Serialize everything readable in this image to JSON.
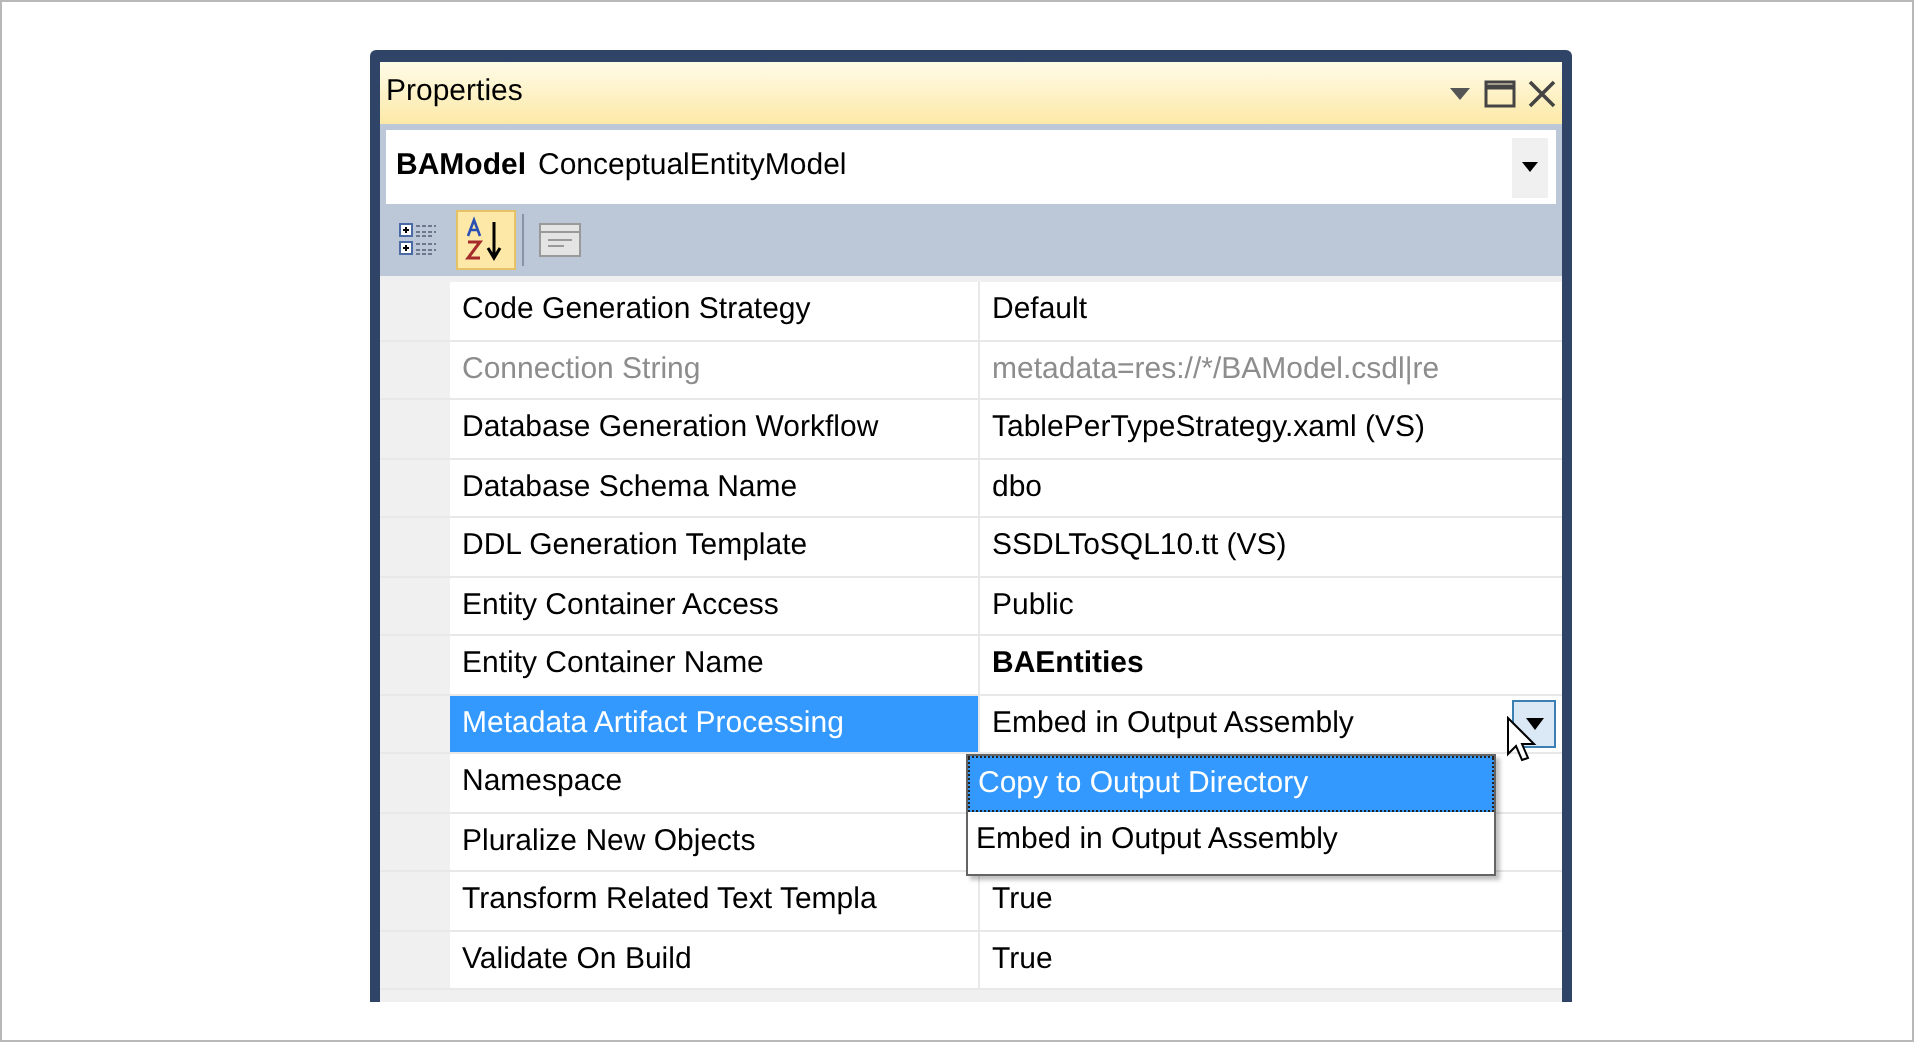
{
  "window": {
    "title": "Properties"
  },
  "object_selector": {
    "name": "BAModel",
    "type": "ConceptualEntityModel"
  },
  "toolbar": [
    {
      "kind": "categorized",
      "selected": false
    },
    {
      "kind": "alphabetical",
      "selected": true
    },
    {
      "kind": "pages",
      "selected": false
    }
  ],
  "properties": [
    {
      "name": "Code Generation Strategy",
      "value": "Default",
      "disabled": false,
      "selected": false
    },
    {
      "name": "Connection String",
      "value": "metadata=res://*/BAModel.csdl|re",
      "disabled": true,
      "selected": false
    },
    {
      "name": "Database Generation Workflow",
      "value": "TablePerTypeStrategy.xaml (VS)",
      "disabled": false,
      "selected": false
    },
    {
      "name": "Database Schema Name",
      "value": "dbo",
      "disabled": false,
      "selected": false
    },
    {
      "name": "DDL Generation Template",
      "value": "SSDLToSQL10.tt (VS)",
      "disabled": false,
      "selected": false
    },
    {
      "name": "Entity Container Access",
      "value": "Public",
      "disabled": false,
      "selected": false
    },
    {
      "name": "Entity Container Name",
      "value": "BAEntities",
      "disabled": false,
      "selected": false,
      "bold": true
    },
    {
      "name": "Metadata Artifact Processing",
      "value": "Embed in Output Assembly",
      "disabled": false,
      "selected": true
    },
    {
      "name": "Namespace",
      "disabled": false,
      "selected": false
    },
    {
      "name": "Pluralize New Objects",
      "disabled": false,
      "selected": false
    },
    {
      "name": "Transform Related Text Templa",
      "value": "True",
      "disabled": false,
      "selected": false
    },
    {
      "name": "Validate On Build",
      "value": "True",
      "disabled": false,
      "selected": false
    }
  ],
  "dropdown_list": [
    {
      "label": "Copy to Output Directory",
      "selected": true
    },
    {
      "label": "Embed in Output Assembly",
      "selected": false
    }
  ]
}
